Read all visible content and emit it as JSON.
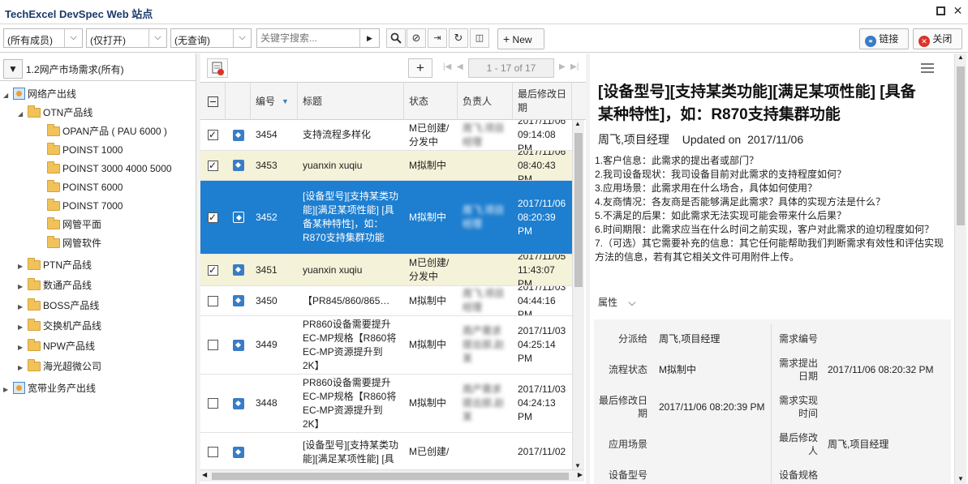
{
  "title_bar": {
    "app_title": "TechExcel DevSpec Web 站点"
  },
  "toolbar": {
    "member_filter": "(所有成员)",
    "open_filter": "(仅打开)",
    "query_filter": "(无查询)",
    "search_placeholder": "关键字搜索...",
    "new_label": "New",
    "link_label": "链接",
    "close_label": "关闭"
  },
  "left_panel": {
    "filter_text": "1.2网产市场需求(所有)",
    "tree": [
      {
        "label": "网络产出线",
        "level": 0,
        "expanded": true,
        "icon": "globe-folder-icon"
      },
      {
        "label": "OTN产品线",
        "level": 1,
        "expanded": true,
        "icon": "folder-icon"
      },
      {
        "label": "OPAN产品 ( PAU 6000 )",
        "level": 2,
        "icon": "folder-icon"
      },
      {
        "label": "POINST 1000",
        "level": 2,
        "icon": "folder-icon"
      },
      {
        "label": "POINST 3000 4000 5000",
        "level": 2,
        "icon": "folder-icon"
      },
      {
        "label": "POINST 6000",
        "level": 2,
        "icon": "folder-icon"
      },
      {
        "label": "POINST 7000",
        "level": 2,
        "icon": "folder-icon"
      },
      {
        "label": "网管平面",
        "level": 2,
        "icon": "folder-icon"
      },
      {
        "label": "网管软件",
        "level": 2,
        "icon": "folder-icon"
      },
      {
        "label": "PTN产品线",
        "level": 1,
        "expanded": false,
        "icon": "folder-icon"
      },
      {
        "label": "数通产品线",
        "level": 1,
        "expanded": false,
        "icon": "folder-icon"
      },
      {
        "label": "BOSS产品线",
        "level": 1,
        "expanded": false,
        "icon": "folder-icon"
      },
      {
        "label": "交换机产品线",
        "level": 1,
        "expanded": false,
        "icon": "folder-icon"
      },
      {
        "label": "NPW产品线",
        "level": 1,
        "expanded": false,
        "icon": "folder-icon"
      },
      {
        "label": "海光超微公司",
        "level": 1,
        "expanded": false,
        "icon": "folder-icon"
      },
      {
        "label": "宽带业务产出线",
        "level": 0,
        "expanded": false,
        "icon": "globe-folder-icon"
      }
    ]
  },
  "list": {
    "pager": "1 - 17 of 17",
    "columns": [
      "编号",
      "标题",
      "状态",
      "负责人",
      "最后修改日期"
    ],
    "rows": [
      {
        "id": "3454",
        "title": "支持流程多样化",
        "status": "M已创建/分发中",
        "owner": "周飞,项目经理",
        "date": "2017/11/06 09:14:08 PM",
        "checked": true,
        "selected": false,
        "highlight": false
      },
      {
        "id": "3453",
        "title": "yuanxin xuqiu",
        "status": "M拟制中",
        "owner": "",
        "date": "2017/11/06 08:40:43 PM",
        "checked": true,
        "selected": false,
        "highlight": true
      },
      {
        "id": "3452",
        "title": "[设备型号][支持某类功能][满足某项性能] [具备某种特性]，如：R870支持集群功能",
        "status": "M拟制中",
        "owner": "周飞,项目经理",
        "date": "2017/11/06 08:20:39 PM",
        "checked": true,
        "selected": true,
        "highlight": false
      },
      {
        "id": "3451",
        "title": "yuanxin xuqiu",
        "status": "M已创建/分发中",
        "owner": "",
        "date": "2017/11/05 11:43:07 PM",
        "checked": true,
        "selected": false,
        "highlight": true
      },
      {
        "id": "3450",
        "title": "【PR845/860/865】112013",
        "status": "M拟制中",
        "owner": "周飞,项目经理",
        "date": "2017/11/03 04:44:16 PM",
        "checked": false,
        "selected": false,
        "highlight": false
      },
      {
        "id": "3449",
        "title": "PR860设备需要提升EC-MP规格【R860将EC-MP资源提升到2K】",
        "status": "M拟制中",
        "owner": "周产需求提出部,赵某",
        "date": "2017/11/03 04:25:14 PM",
        "checked": false,
        "selected": false,
        "highlight": false
      },
      {
        "id": "3448",
        "title": "PR860设备需要提升EC-MP规格【R860将EC-MP资源提升到2K】",
        "status": "M拟制中",
        "owner": "周产需求提出部,赵某",
        "date": "2017/11/03 04:24:13 PM",
        "checked": false,
        "selected": false,
        "highlight": false
      },
      {
        "id": "",
        "title": "[设备型号][支持某类功能][满足某项性能] [具",
        "status": "M已创建/",
        "owner": "",
        "date": "2017/11/02",
        "checked": false,
        "selected": false,
        "highlight": false
      }
    ]
  },
  "detail": {
    "title": "[设备型号][支持某类功能][满足某项性能] [具备某种特性]，如：R870支持集群功能",
    "author": "周飞,项目经理",
    "updated_label": "Updated on",
    "updated_date": "2017/11/06",
    "description": [
      "1.客户信息：此需求的提出者或部门？",
      "2.我司设备现状：我司设备目前对此需求的支持程度如何？",
      "3.应用场景：此需求用在什么场合，具体如何使用？",
      "4.友商情况：各友商是否能够满足此需求？具体的实现方法是什么？",
      "5.不满足的后果：如此需求无法实现可能会带来什么后果？",
      "6.时间期限：此需求应当在什么时间之前实现，客户对此需求的迫切程度如何？",
      "7.（可选）其它需要补充的信息：其它任何能帮助我们判断需求有效性和评估实现方法的信息，若有其它相关文件可用附件上传。"
    ],
    "properties_label": "属性",
    "props": {
      "assign_label": "分派给",
      "assign_value": "周飞,项目经理",
      "req_no_label": "需求编号",
      "req_no_value": "",
      "flow_label": "流程状态",
      "flow_value": "M拟制中",
      "req_date_label": "需求提出日期",
      "req_date_value": "2017/11/06 08:20:32 PM",
      "last_mod_label": "最后修改日期",
      "last_mod_value": "2017/11/06 08:20:39 PM",
      "realize_label": "需求实现时间",
      "realize_value": "",
      "scene_label": "应用场景",
      "scene_value": "",
      "last_modifier_label": "最后修改人",
      "last_modifier_value": "周飞,项目经理",
      "model_label": "设备型号",
      "spec_label": "设备规格"
    }
  }
}
